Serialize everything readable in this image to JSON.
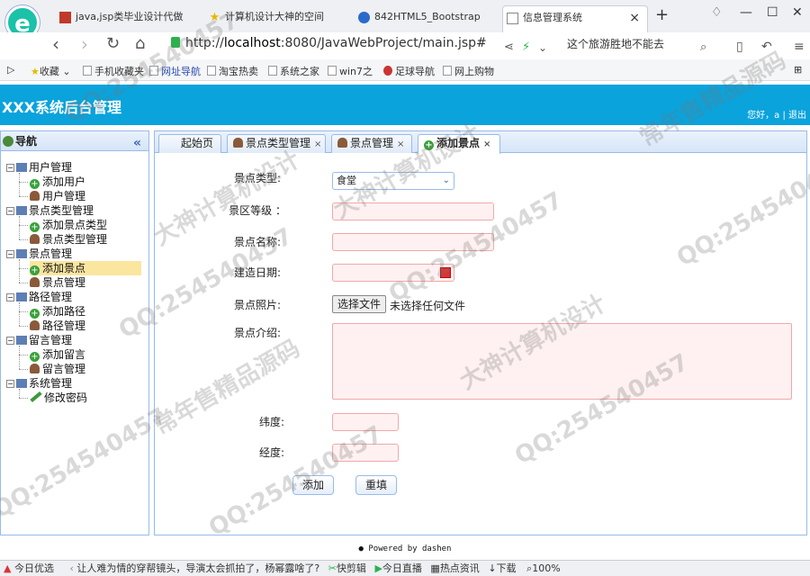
{
  "browser": {
    "tabs": [
      {
        "label": "java,jsp类毕业设计代做"
      },
      {
        "label": "计算机设计大神的空间"
      },
      {
        "label": "842HTML5_Bootstrap"
      },
      {
        "label": "信息管理系统"
      }
    ],
    "new_tab": "+",
    "url_prefix": "http://",
    "url_host": "localhost",
    "url_rest": ":8080/JavaWebProject/main.jsp#",
    "search_text": "这个旅游胜地不能去",
    "bookmarks": [
      "收藏",
      "手机收藏夹",
      "网址导航",
      "淘宝热卖",
      "系统之家",
      "win7之",
      "足球导航",
      "网上购物"
    ]
  },
  "app": {
    "title": "XXX系统后台管理",
    "greeting": "您好，a",
    "separator": "|",
    "logout": "退出"
  },
  "sidebar": {
    "title": "导航",
    "collapse": "«",
    "groups": [
      {
        "label": "用户管理",
        "items": [
          "添加用户",
          "用户管理"
        ]
      },
      {
        "label": "景点类型管理",
        "items": [
          "添加景点类型",
          "景点类型管理"
        ]
      },
      {
        "label": "景点管理",
        "items": [
          "添加景点",
          "景点管理"
        ]
      },
      {
        "label": "路径管理",
        "items": [
          "添加路径",
          "路径管理"
        ]
      },
      {
        "label": "留言管理",
        "items": [
          "添加留言",
          "留言管理"
        ]
      },
      {
        "label": "系统管理",
        "items": [
          "修改密码"
        ]
      }
    ],
    "selected": "添加景点"
  },
  "content_tabs": [
    {
      "label": "起始页"
    },
    {
      "label": "景点类型管理",
      "close": "×"
    },
    {
      "label": "景点管理",
      "close": "×"
    },
    {
      "label": "添加景点",
      "close": "×"
    }
  ],
  "form": {
    "type_label": "景点类型:",
    "type_value": "食堂",
    "level_label": "景区等级 ：",
    "name_label": "景点名称:",
    "date_label": "建造日期:",
    "photo_label": "景点照片:",
    "file_button": "选择文件",
    "file_status": "未选择任何文件",
    "intro_label": "景点介绍:",
    "lat_label": "纬度:",
    "lng_label": "经度:",
    "add_button": "添加",
    "reset_button": "重填"
  },
  "footer": "Powered by dashen",
  "statusbar": {
    "left": "今日优选",
    "news": "让人难为情的穿帮镜头，导演太会抓拍了，杨幂露啥了?",
    "items": [
      "快剪辑",
      "今日直播",
      "热点资讯",
      "下载"
    ],
    "zoom": "100%"
  },
  "watermarks": [
    "QQ:254540457",
    "大神计算机设计",
    "常年售精品源码"
  ],
  "colors": {
    "header": "#0aa3dc",
    "invalid_field": "#fff1f1",
    "selected": "#fbe6a0"
  }
}
